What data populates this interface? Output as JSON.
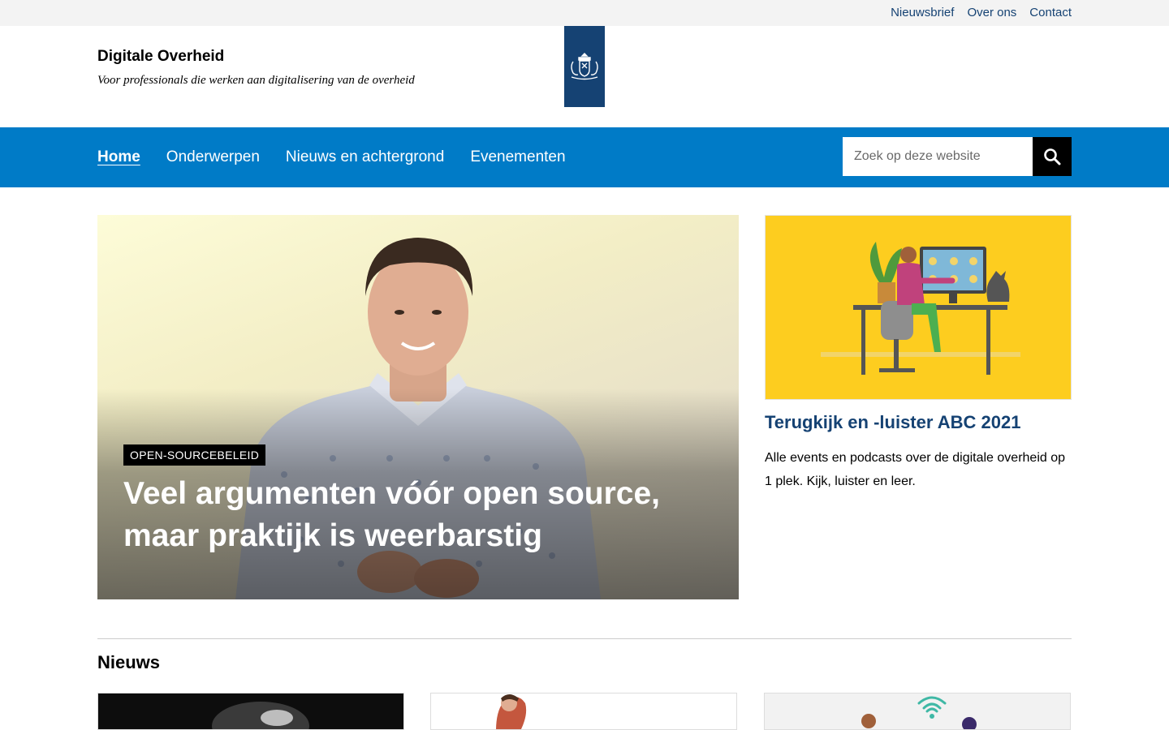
{
  "topbar": {
    "links": [
      "Nieuwsbrief",
      "Over ons",
      "Contact"
    ]
  },
  "header": {
    "title": "Digitale Overheid",
    "tagline": "Voor professionals die werken aan digitalisering van de overheid",
    "logo_icon": "crest-icon"
  },
  "nav": {
    "items": [
      "Home",
      "Onderwerpen",
      "Nieuws en achtergrond",
      "Evenementen"
    ],
    "active": "Home",
    "search_placeholder": "Zoek op deze website",
    "search_icon": "search-icon"
  },
  "hero": {
    "tag": "OPEN-SOURCEBELEID",
    "title": "Veel argumenten vóór open source, maar praktijk is weerbarstig"
  },
  "feature": {
    "title": "Terugkijk en -luister ABC 2021",
    "text": "Alle events en podcasts over de digitale overheid op 1 plek. Kijk, luister en leer."
  },
  "news": {
    "heading": "Nieuws"
  },
  "colors": {
    "nav_blue": "#007bc7",
    "brand_dark_blue": "#154273",
    "feature_yellow": "#fdcd1f"
  }
}
